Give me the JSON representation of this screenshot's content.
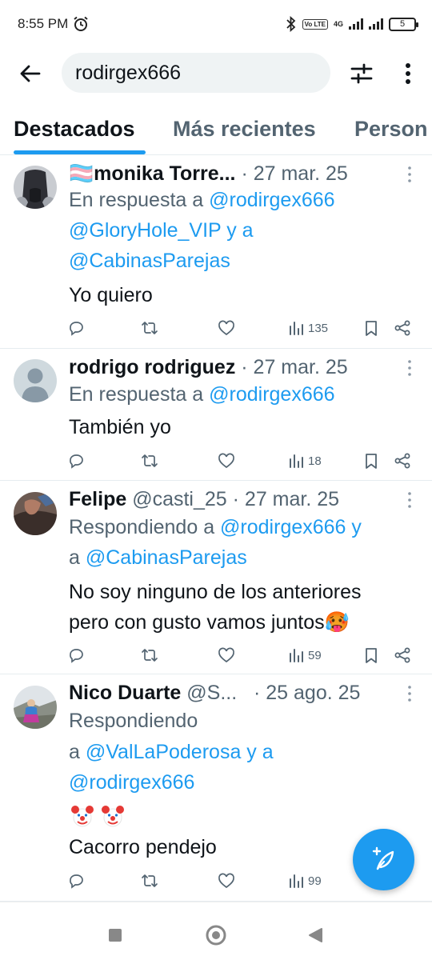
{
  "status_bar": {
    "time": "8:55 PM",
    "volte_label": "Vo LTE",
    "network_label": "4G",
    "battery": "5"
  },
  "search": {
    "query": "rodirgex666"
  },
  "tabs": [
    {
      "label": "Destacados",
      "active": true
    },
    {
      "label": "Más recientes",
      "active": false
    },
    {
      "label": "Person",
      "active": false
    }
  ],
  "tweets": [
    {
      "name": "🏳️‍⚧️monika Torre...",
      "handle": "",
      "date": "· 27 mar. 25",
      "reply_lines": [
        {
          "gray": "En respuesta a ",
          "blue": "@rodirgex666"
        },
        {
          "gray": "",
          "blue": "@GloryHole_VIP y a"
        },
        {
          "gray": "",
          "blue": "@CabinasParejas"
        }
      ],
      "text_lines": [
        "Yo quiero"
      ],
      "views": "135"
    },
    {
      "name": "rodrigo rodriguez",
      "handle": "",
      "date": "· 27 mar. 25",
      "reply_lines": [
        {
          "gray": "En respuesta a ",
          "blue": "@rodirgex666"
        }
      ],
      "text_lines": [
        "También yo"
      ],
      "views": "18"
    },
    {
      "name": "Felipe",
      "handle": "@casti_25",
      "date": "· 27 mar. 25",
      "reply_lines": [
        {
          "gray": "Respondiendo a ",
          "blue": "@rodirgex666 y"
        },
        {
          "gray": "a ",
          "blue": "@CabinasParejas"
        }
      ],
      "text_lines": [
        "No soy ninguno de los anteriores",
        "pero con gusto vamos juntos🥵"
      ],
      "views": "59"
    },
    {
      "name": "Nico Duarte",
      "handle": "@S...",
      "date": "· 25 ago. 25",
      "reply_lines": [
        {
          "gray": "Respondiendo",
          "blue": ""
        },
        {
          "gray": "a ",
          "blue": "@ValLaPoderosa y a"
        },
        {
          "gray": "",
          "blue": "@rodirgex666"
        }
      ],
      "text_lines": [
        "🤡🤡",
        "Cacorro pendejo"
      ],
      "views": "99"
    }
  ],
  "colors": {
    "accent": "#1d9bf0",
    "text": "#0f1419",
    "secondary": "#536471",
    "divider": "#e6ecf0"
  }
}
